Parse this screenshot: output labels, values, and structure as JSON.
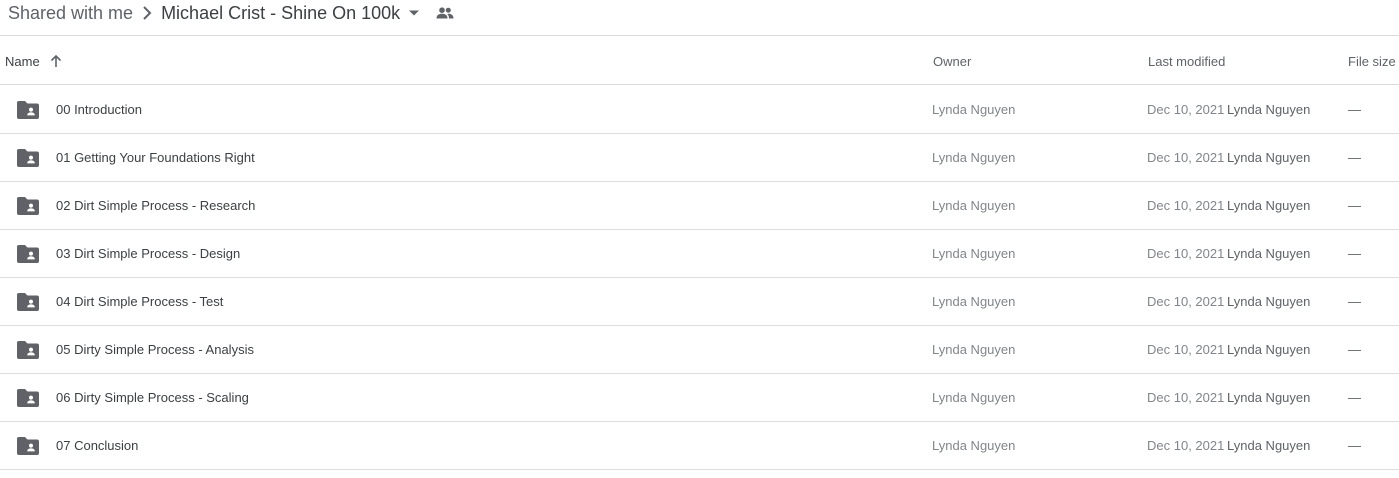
{
  "breadcrumb": {
    "root": "Shared with me",
    "current": "Michael Crist - Shine On 100k",
    "icons": [
      "chevron-right-icon",
      "caret-down-icon",
      "shared-people-icon"
    ]
  },
  "columns": {
    "name": "Name",
    "owner": "Owner",
    "last_modified": "Last modified",
    "file_size": "File size",
    "sort_icon": "arrow-up-icon"
  },
  "rows": [
    {
      "name": "00 Introduction",
      "owner": "Lynda Nguyen",
      "date": "Dec 10, 2021",
      "modified_by": "Lynda Nguyen",
      "size": "—",
      "icon": "shared-folder-icon"
    },
    {
      "name": "01 Getting Your Foundations Right",
      "owner": "Lynda Nguyen",
      "date": "Dec 10, 2021",
      "modified_by": "Lynda Nguyen",
      "size": "—",
      "icon": "shared-folder-icon"
    },
    {
      "name": "02 Dirt Simple Process - Research",
      "owner": "Lynda Nguyen",
      "date": "Dec 10, 2021",
      "modified_by": "Lynda Nguyen",
      "size": "—",
      "icon": "shared-folder-icon"
    },
    {
      "name": "03 Dirt Simple Process - Design",
      "owner": "Lynda Nguyen",
      "date": "Dec 10, 2021",
      "modified_by": "Lynda Nguyen",
      "size": "—",
      "icon": "shared-folder-icon"
    },
    {
      "name": "04 Dirt Simple Process - Test",
      "owner": "Lynda Nguyen",
      "date": "Dec 10, 2021",
      "modified_by": "Lynda Nguyen",
      "size": "—",
      "icon": "shared-folder-icon"
    },
    {
      "name": "05 Dirty Simple Process - Analysis",
      "owner": "Lynda Nguyen",
      "date": "Dec 10, 2021",
      "modified_by": "Lynda Nguyen",
      "size": "—",
      "icon": "shared-folder-icon"
    },
    {
      "name": "06 Dirty Simple Process - Scaling",
      "owner": "Lynda Nguyen",
      "date": "Dec 10, 2021",
      "modified_by": "Lynda Nguyen",
      "size": "—",
      "icon": "shared-folder-icon"
    },
    {
      "name": "07 Conclusion",
      "owner": "Lynda Nguyen",
      "date": "Dec 10, 2021",
      "modified_by": "Lynda Nguyen",
      "size": "—",
      "icon": "shared-folder-icon"
    }
  ],
  "colors": {
    "icon": "#5f6368",
    "divider": "#dadce0",
    "text_primary": "#3c4043",
    "text_secondary": "#80868b"
  }
}
